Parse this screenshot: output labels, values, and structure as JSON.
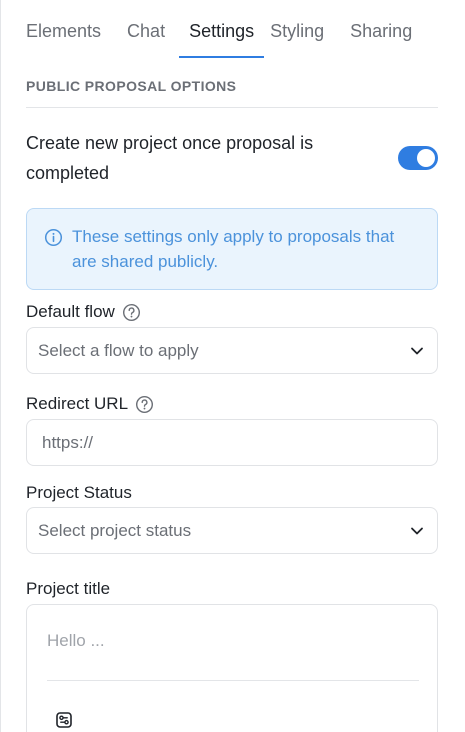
{
  "tabs": [
    {
      "label": "Elements",
      "active": false
    },
    {
      "label": "Chat",
      "active": false
    },
    {
      "label": "Settings",
      "active": true
    },
    {
      "label": "Styling",
      "active": false
    },
    {
      "label": "Sharing",
      "active": false
    }
  ],
  "section": {
    "heading": "PUBLIC PROPOSAL OPTIONS"
  },
  "create_project": {
    "label": "Create new project once proposal is completed",
    "enabled": true
  },
  "info": {
    "icon": "info-circle-icon",
    "text": "These settings only apply to proposals that are shared publicly."
  },
  "default_flow": {
    "label": "Default flow",
    "placeholder": "Select a flow to apply"
  },
  "redirect_url": {
    "label": "Redirect URL",
    "value": "https://"
  },
  "project_status": {
    "label": "Project Status",
    "placeholder": "Select project status"
  },
  "project_title": {
    "label": "Project title",
    "placeholder": "Hello ...",
    "toolbar_icon": "variable-icon"
  },
  "colors": {
    "accent": "#2f7de1",
    "info_bg": "#eaf4fd",
    "info_text": "#4b92db",
    "muted": "#6b6f76"
  }
}
